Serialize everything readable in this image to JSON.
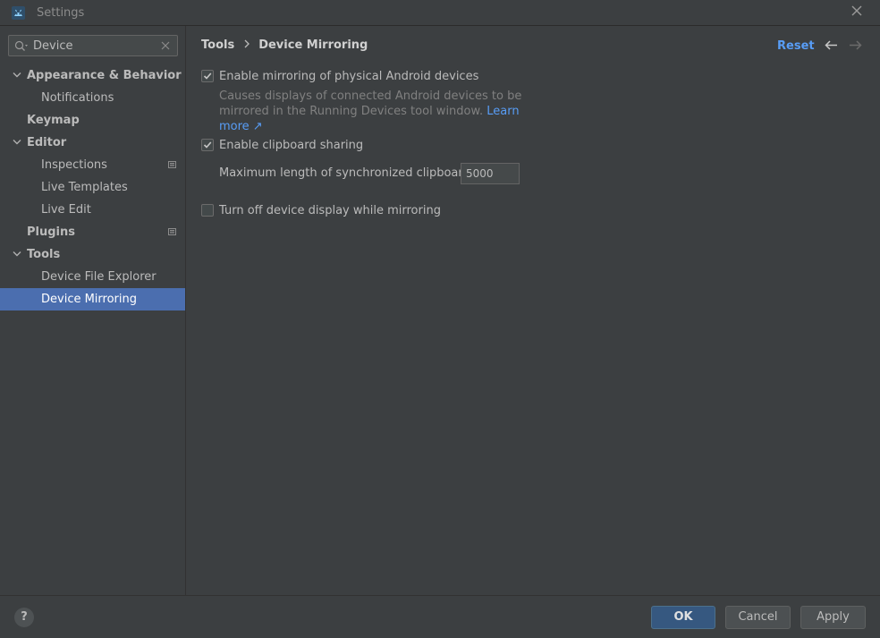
{
  "window": {
    "title": "Settings"
  },
  "search": {
    "value": "Device",
    "placeholder": ""
  },
  "sidebar": {
    "items": [
      {
        "label": "Appearance & Behavior"
      },
      {
        "label": "Notifications"
      },
      {
        "label": "Keymap"
      },
      {
        "label": "Editor"
      },
      {
        "label": "Inspections"
      },
      {
        "label": "Live Templates"
      },
      {
        "label": "Live Edit"
      },
      {
        "label": "Plugins"
      },
      {
        "label": "Tools"
      },
      {
        "label": "Device File Explorer"
      },
      {
        "label": "Device Mirroring"
      }
    ],
    "selected_label": "Device Mirroring"
  },
  "breadcrumb": {
    "parent": "Tools",
    "current": "Device Mirroring"
  },
  "toolbar": {
    "reset_label": "Reset"
  },
  "options": {
    "mirroring": {
      "label": "Enable mirroring of physical Android devices",
      "checked": true,
      "description": "Causes displays of connected Android devices to be mirrored in the Running Devices tool window.",
      "link_label": "Learn more ↗"
    },
    "clipboard": {
      "label": "Enable clipboard sharing",
      "checked": true,
      "max_length_label": "Maximum length of synchronized clipboard text:",
      "max_length_value": "5000"
    },
    "turn_off_display": {
      "label": "Turn off device display while mirroring",
      "checked": false
    }
  },
  "footer": {
    "help_label": "?",
    "ok_label": "OK",
    "cancel_label": "Cancel",
    "apply_label": "Apply"
  },
  "colors": {
    "background": "#3c3f41",
    "selection": "#4b6eaf",
    "link": "#589df6",
    "primary_button": "#365880"
  }
}
